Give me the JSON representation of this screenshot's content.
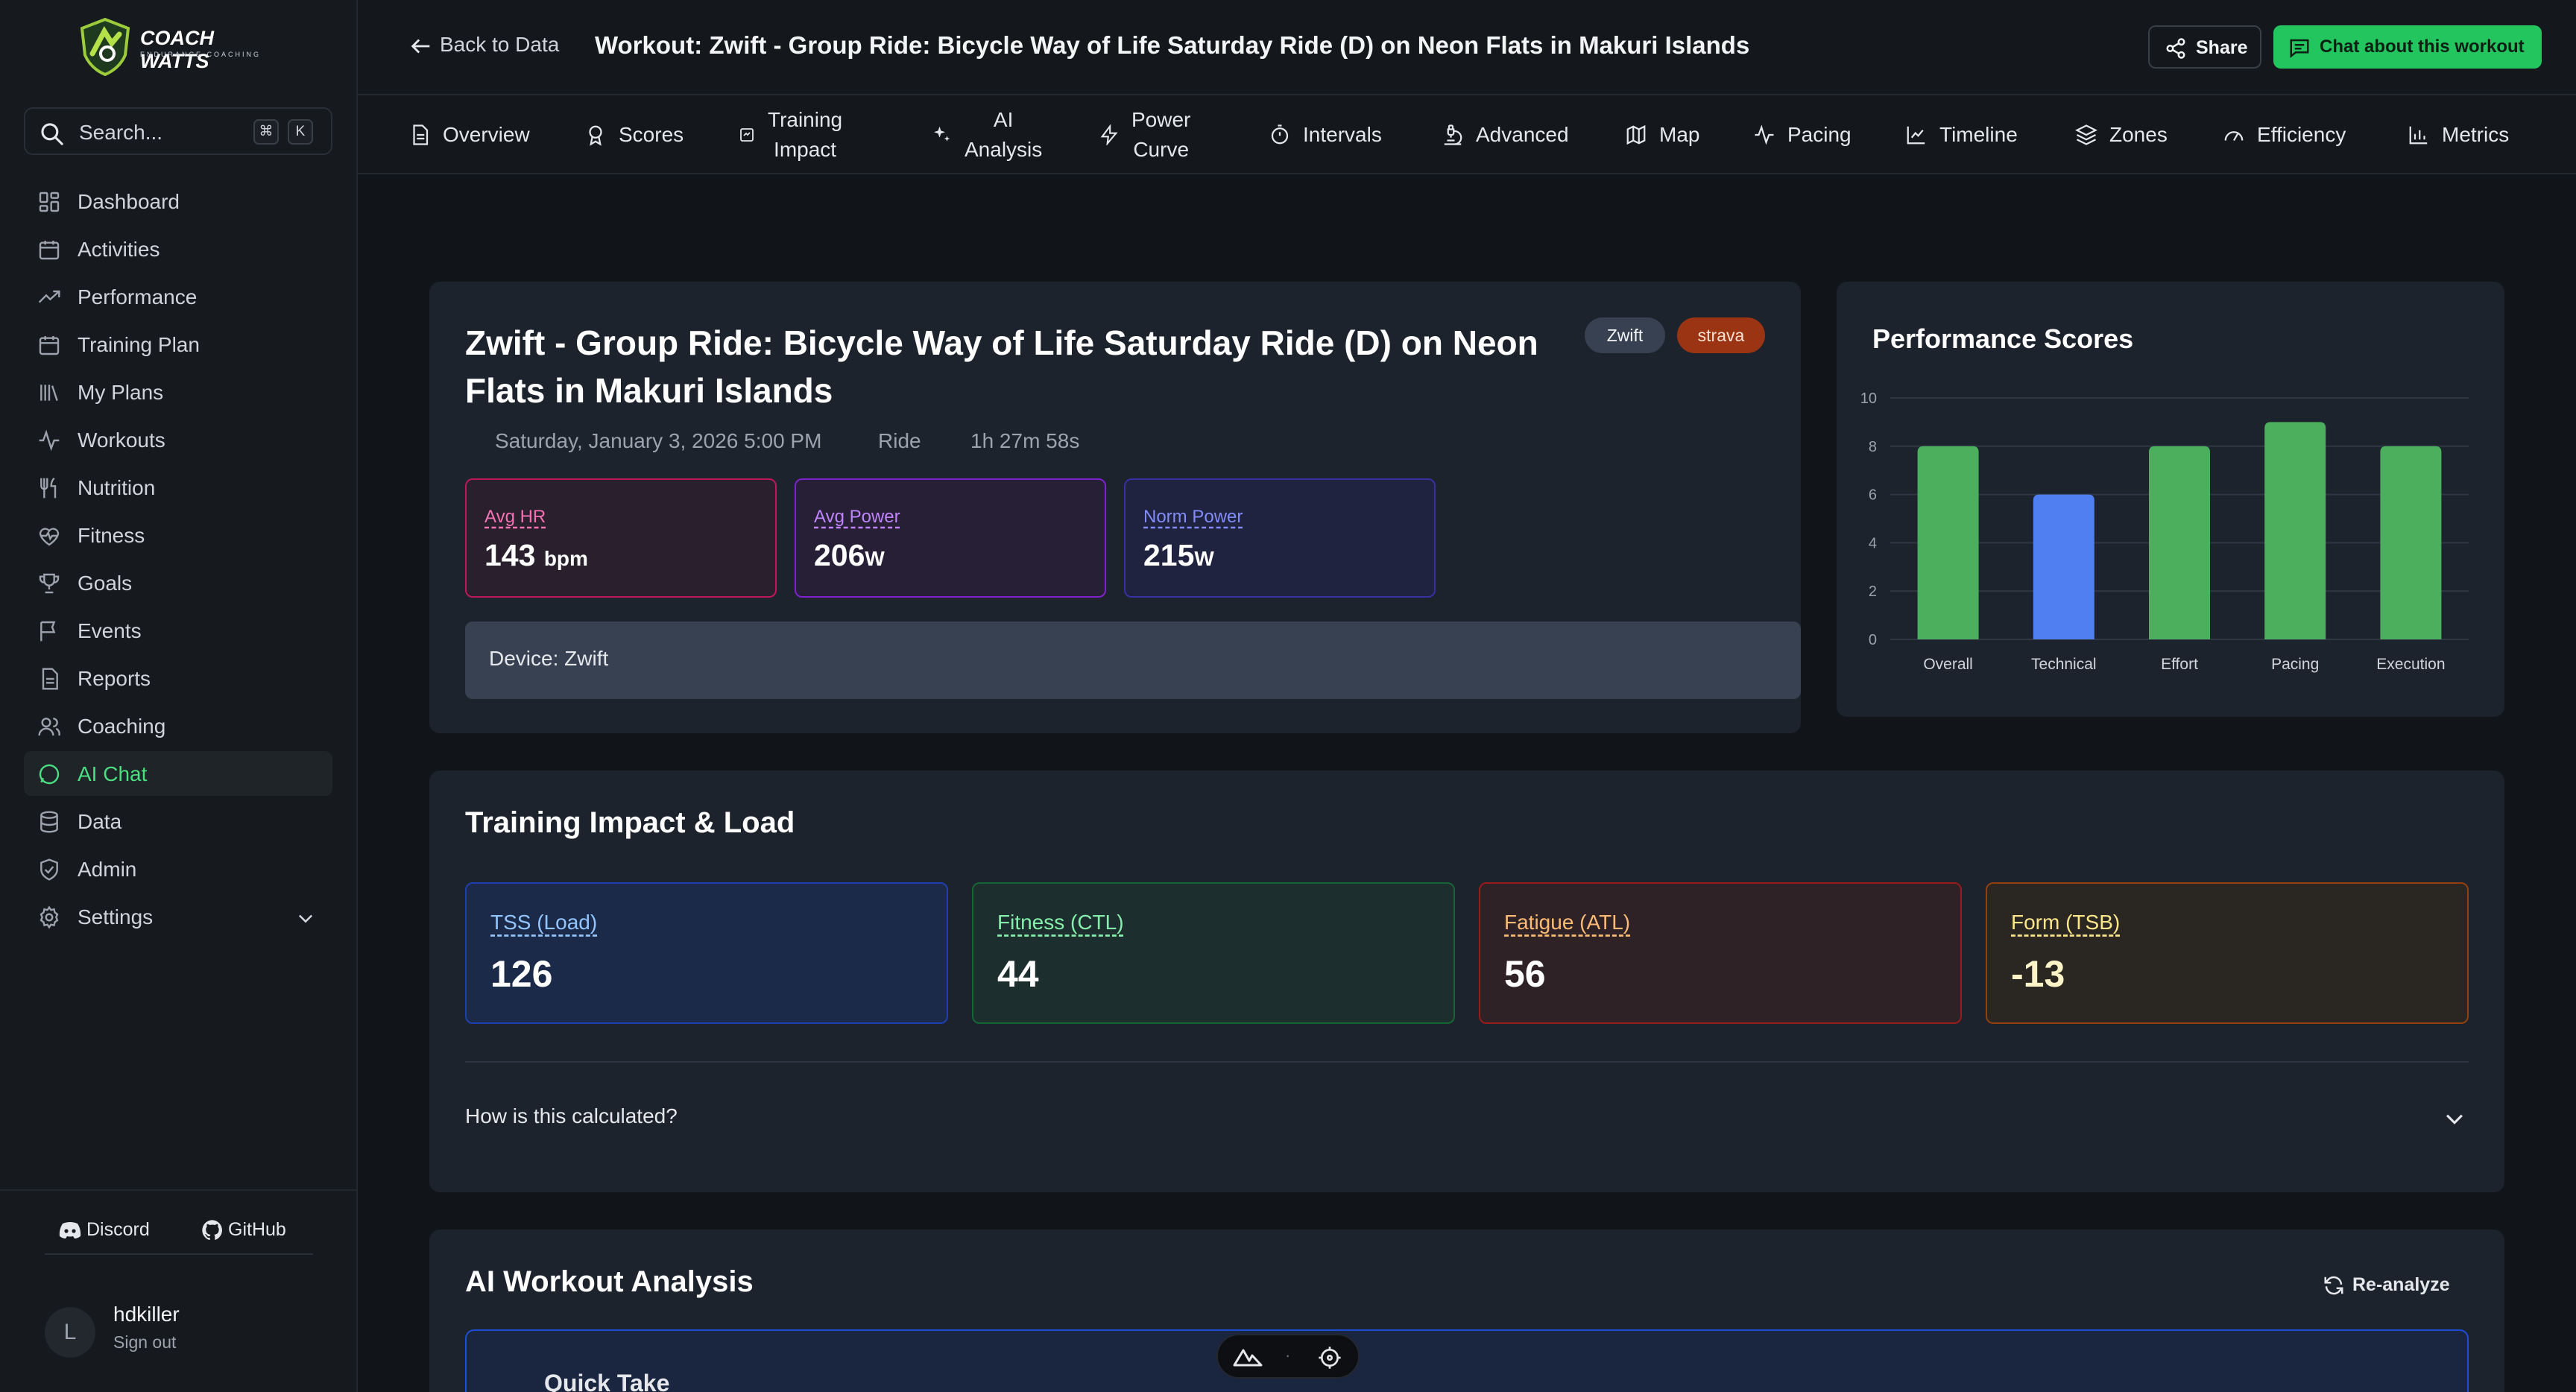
{
  "brand": {
    "name": "COACH WATTS",
    "tagline": "ENDURANCE COACHING",
    "accent": "#22c55e"
  },
  "sidebar": {
    "search_placeholder": "Search...",
    "shortcut": [
      "⌘",
      "K"
    ],
    "items": [
      {
        "label": "Dashboard",
        "icon": "dashboard-icon"
      },
      {
        "label": "Activities",
        "icon": "calendar-icon"
      },
      {
        "label": "Performance",
        "icon": "trending-up-icon"
      },
      {
        "label": "Training Plan",
        "icon": "calendar-plan-icon"
      },
      {
        "label": "My Plans",
        "icon": "library-icon"
      },
      {
        "label": "Workouts",
        "icon": "activity-icon"
      },
      {
        "label": "Nutrition",
        "icon": "utensils-icon"
      },
      {
        "label": "Fitness",
        "icon": "heart-pulse-icon"
      },
      {
        "label": "Goals",
        "icon": "trophy-icon"
      },
      {
        "label": "Events",
        "icon": "flag-icon"
      },
      {
        "label": "Reports",
        "icon": "file-text-icon"
      },
      {
        "label": "Coaching",
        "icon": "users-icon"
      },
      {
        "label": "AI Chat",
        "icon": "message-circle-icon",
        "active": true
      },
      {
        "label": "Data",
        "icon": "database-icon"
      },
      {
        "label": "Admin",
        "icon": "shield-icon"
      },
      {
        "label": "Settings",
        "icon": "gear-icon"
      }
    ],
    "footer": {
      "discord": "Discord",
      "github": "GitHub"
    },
    "user": {
      "initial": "L",
      "name": "hdkiller",
      "signout": "Sign out"
    }
  },
  "header": {
    "back_label": "Back to Data",
    "title": "Workout: Zwift - Group Ride: Bicycle Way of Life Saturday Ride (D) on Neon Flats in Makuri Islands",
    "share_label": "Share",
    "chat_label": "Chat about this workout"
  },
  "tabs": [
    {
      "label": "Overview"
    },
    {
      "label": "Scores"
    },
    {
      "label": "Training\nImpact"
    },
    {
      "label": "AI\nAnalysis"
    },
    {
      "label": "Power\nCurve"
    },
    {
      "label": "Intervals"
    },
    {
      "label": "Advanced"
    },
    {
      "label": "Map"
    },
    {
      "label": "Pacing"
    },
    {
      "label": "Timeline"
    },
    {
      "label": "Zones"
    },
    {
      "label": "Efficiency"
    },
    {
      "label": "Metrics"
    }
  ],
  "workout": {
    "title": "Zwift - Group Ride: Bicycle Way of Life Saturday Ride (D) on Neon Flats in Makuri Islands",
    "badges": [
      "Zwift",
      "strava"
    ],
    "date": "Saturday, January 3, 2026 5:00 PM",
    "type": "Ride",
    "duration": "1h 27m 58s",
    "metrics": [
      {
        "label": "Avg HR",
        "value": "143",
        "unit": "bpm"
      },
      {
        "label": "Avg Power",
        "value": "206",
        "unit": "W"
      },
      {
        "label": "Norm Power",
        "value": "215",
        "unit": "W"
      }
    ],
    "device": "Device: Zwift"
  },
  "scores_card": {
    "title": "Performance Scores"
  },
  "chart_data": {
    "type": "bar",
    "title": "Performance Scores",
    "categories": [
      "Overall",
      "Technical",
      "Effort",
      "Pacing",
      "Execution"
    ],
    "values": [
      8,
      6,
      8,
      9,
      8
    ],
    "colors": [
      "#4caf5d",
      "#4f7ff0",
      "#4caf5d",
      "#4caf5d",
      "#4caf5d"
    ],
    "ylim": [
      0,
      10
    ],
    "yticks": [
      "0",
      "2",
      "4",
      "6",
      "8",
      "10"
    ],
    "grid": true
  },
  "training": {
    "title": "Training Impact & Load",
    "cards": [
      {
        "label": "TSS (Load)",
        "value": "126"
      },
      {
        "label": "Fitness (CTL)",
        "value": "44"
      },
      {
        "label": "Fatigue (ATL)",
        "value": "56"
      },
      {
        "label": "Form (TSB)",
        "value": "-13"
      }
    ],
    "calc_label": "How is this calculated?"
  },
  "analysis": {
    "title": "AI Workout Analysis",
    "reanalyze": "Re-analyze",
    "quick_take": "Quick Take"
  },
  "devbar": {
    "separator": "·"
  }
}
